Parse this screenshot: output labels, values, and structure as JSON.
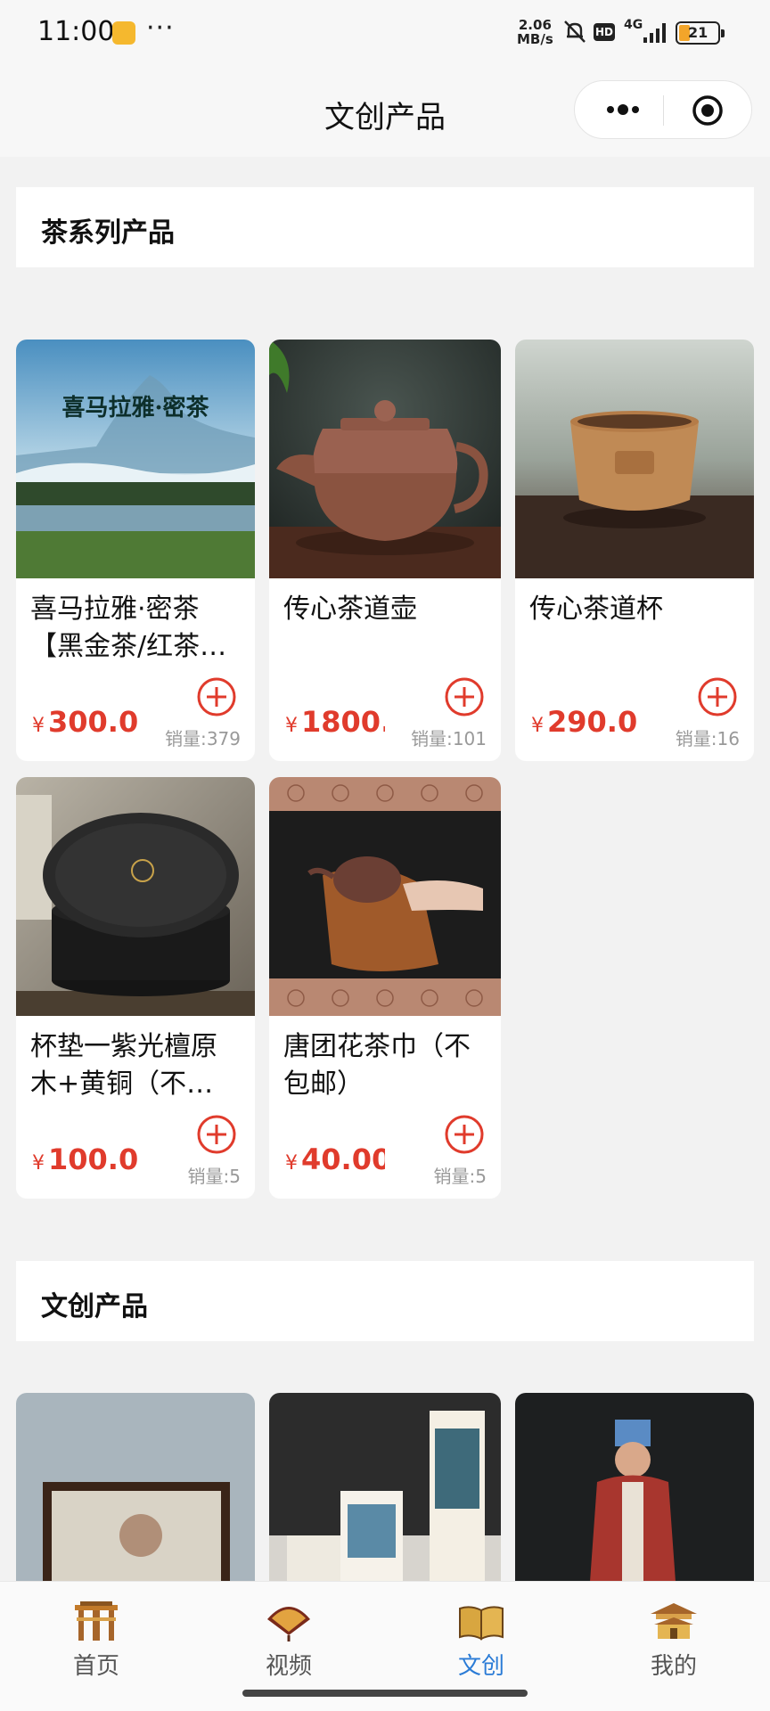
{
  "status_bar": {
    "time": "11:00",
    "dots": "···",
    "net_speed_value": "2.06",
    "net_speed_unit": "MB/s",
    "hd": "HD",
    "network": "4G",
    "battery": "21"
  },
  "nav": {
    "title": "文创产品"
  },
  "sections": [
    {
      "title": "茶系列产品",
      "products": [
        {
          "name": "喜马拉雅·密茶【黑金茶/红茶…",
          "currency": "¥",
          "price": "300.0",
          "sales_label": "销量:",
          "sales": "379"
        },
        {
          "name": "传心茶道壶",
          "currency": "¥",
          "price": "1800.",
          "sales_label": "销量:",
          "sales": "101"
        },
        {
          "name": "传心茶道杯",
          "currency": "¥",
          "price": "290.0",
          "sales_label": "销量:",
          "sales": "16"
        },
        {
          "name": "杯垫一紫光檀原木+黄铜（不…",
          "currency": "¥",
          "price": "100.0",
          "sales_label": "销量:",
          "sales": "5"
        },
        {
          "name": "唐团花茶巾（不包邮）",
          "currency": "¥",
          "price": "40.00",
          "sales_label": "销量:",
          "sales": "5"
        }
      ]
    },
    {
      "title": "文创产品"
    }
  ],
  "image_texts": {
    "himalaya_banner": "喜马拉雅·密茶"
  },
  "tabbar": [
    {
      "label": "首页",
      "icon": "archway-icon"
    },
    {
      "label": "视频",
      "icon": "fan-icon"
    },
    {
      "label": "文创",
      "icon": "book-icon",
      "active": true
    },
    {
      "label": "我的",
      "icon": "palace-icon"
    }
  ],
  "colors": {
    "price": "#e03b2c",
    "active_tab": "#2a7bd6",
    "background": "#f2f2f2"
  }
}
